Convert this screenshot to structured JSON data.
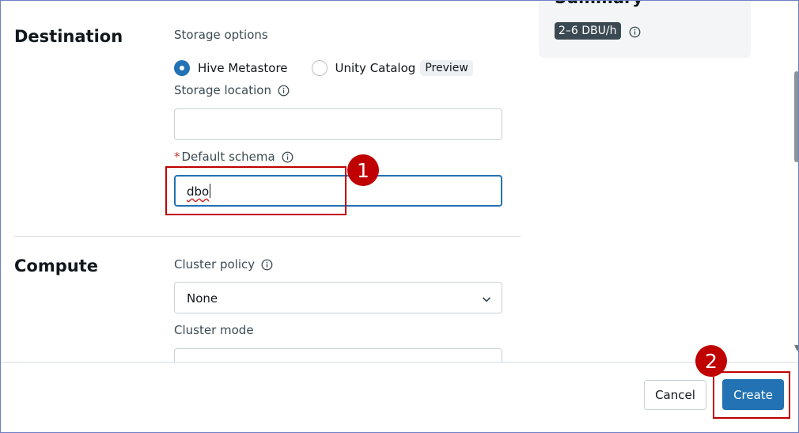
{
  "summary": {
    "title": "Summary",
    "dbu": "2–6 DBU/h"
  },
  "destination": {
    "section_title": "Destination",
    "storage_options_label": "Storage options",
    "options": [
      {
        "label": "Hive Metastore",
        "checked": true
      },
      {
        "label": "Unity Catalog",
        "checked": false,
        "tag": "Preview"
      }
    ],
    "storage_location_label": "Storage location",
    "storage_location_value": "",
    "default_schema_required_mark": "*",
    "default_schema_label": "Default schema",
    "default_schema_value": "dbo"
  },
  "compute": {
    "section_title": "Compute",
    "cluster_policy_label": "Cluster policy",
    "cluster_policy_value": "None",
    "cluster_mode_label": "Cluster mode"
  },
  "footer": {
    "cancel_label": "Cancel",
    "create_label": "Create"
  },
  "annotations": {
    "step1": "1",
    "step2": "2"
  },
  "colors": {
    "accent": "#2272b4",
    "annotation": "#c00000"
  },
  "icons": {
    "info": "info-icon",
    "chevron": "chevron-down-icon"
  }
}
